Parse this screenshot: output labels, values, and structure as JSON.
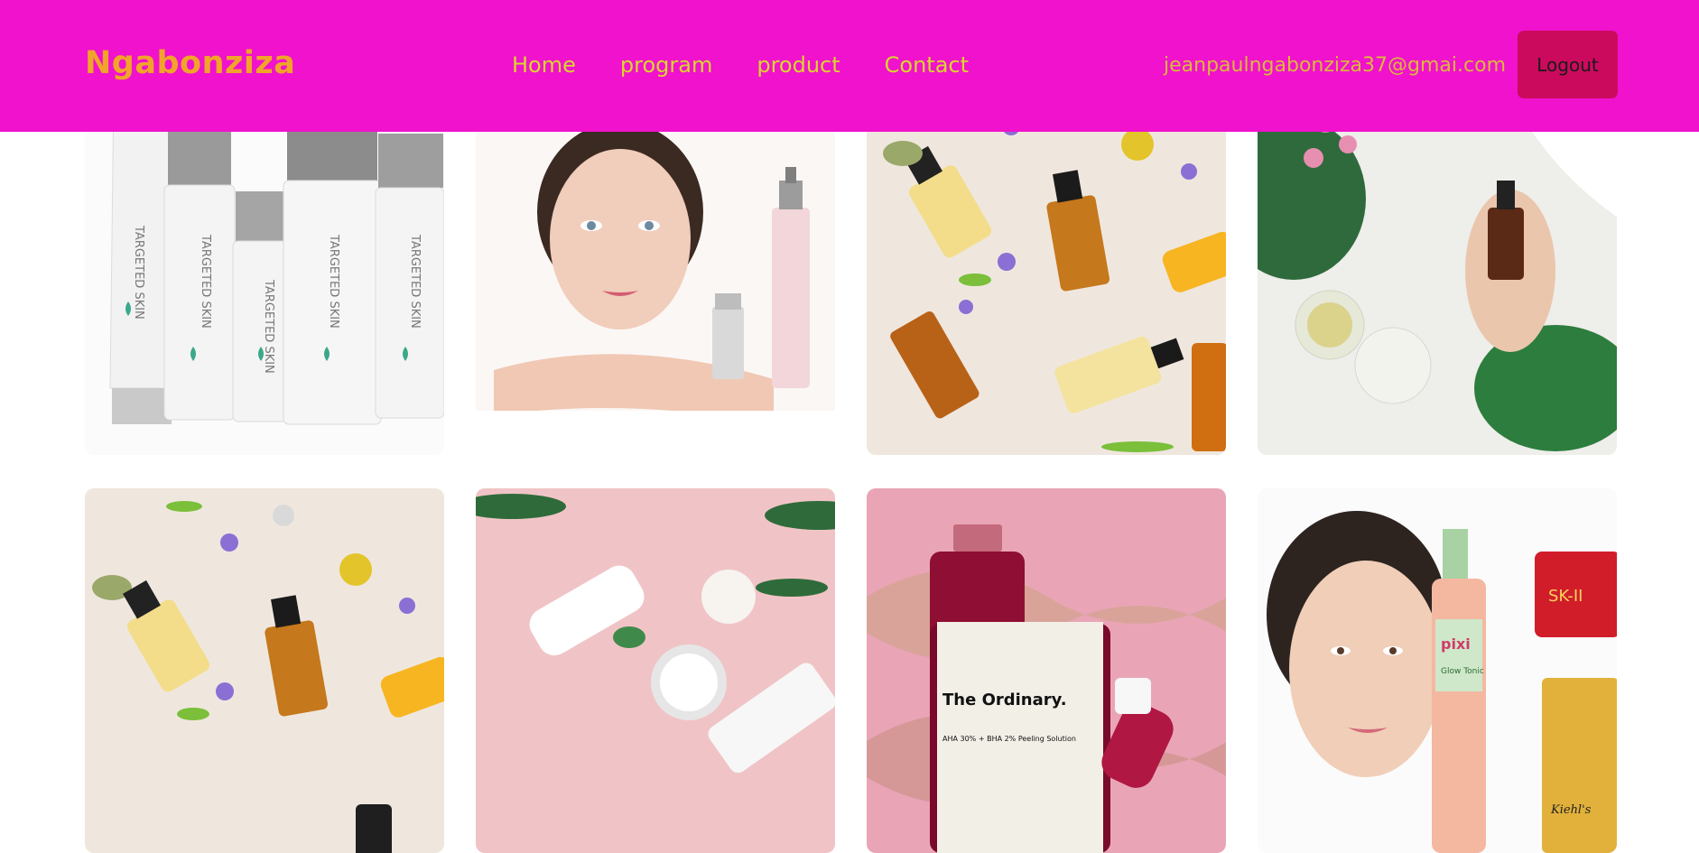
{
  "header": {
    "brand": "Ngabonziza",
    "nav": [
      {
        "label": "Home"
      },
      {
        "label": "program"
      },
      {
        "label": "product"
      },
      {
        "label": "Contact"
      }
    ],
    "user_email": "jeanpaulngabonziza37@gmai.com",
    "logout_label": "Logout"
  },
  "colors": {
    "header_bg": "#f012cc",
    "brand": "#f0a42a",
    "nav_text": "#d8d62e",
    "logout_bg": "#cc0a5d"
  },
  "products": [
    {
      "image": "targeted-skin-bottles-image",
      "labels": [
        "TARGETED SKIN",
        "TARGETED SKIN",
        "TARGETED SKIN",
        "TARGETED SKIN",
        "TARGETED SKIN"
      ]
    },
    {
      "image": "woman-face-with-serum-image"
    },
    {
      "image": "serum-bottles-flatlay-image"
    },
    {
      "image": "hands-holding-dropper-bottle-image"
    },
    {
      "image": "serum-bottles-flatlay-image-2"
    },
    {
      "image": "pink-cosmetics-flatlay-image"
    },
    {
      "image": "the-ordinary-serum-image",
      "brand_label": "The Ordinary.",
      "sub_label": "AHA 30% + BHA 2% Peeling Solution"
    },
    {
      "image": "woman-with-skincare-products-image",
      "brand_label": "pixi",
      "sub_label": "Glow Tonic",
      "brand_label_2": "SK-II",
      "brand_label_3": "Kiehl's"
    }
  ]
}
